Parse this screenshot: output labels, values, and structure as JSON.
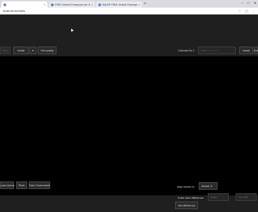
{
  "browser": {
    "tabs": [
      {
        "label": "",
        "active": true
      },
      {
        "label": "FIBS Global Champion for 3D",
        "active": false
      },
      {
        "label": "BAGR FIBS Global Champion",
        "active": false
      }
    ],
    "new_tab": "+",
    "window_controls": [
      "–",
      "□",
      "✕"
    ],
    "url": "localhost.domains"
  },
  "top_controls": {
    "left_btn_a": "Sex",
    "left_btn_b": "Install",
    "left_dropdown": "▾",
    "left_btn_quality": "Set quality",
    "channel_label": "Channel Nr 2",
    "channel_input_placeholder": "Set 2 / / / / / / / / ",
    "right_btn_install": "Install",
    "right_btn_edge": "Set"
  },
  "bottom_controls": {
    "btn_videos": "Load videos",
    "btn_pixel": "Pixel",
    "btn_screenshot": "Take Screenshot",
    "map_shown_label": "Map shown in",
    "map_select_value": "ahead",
    "time_diff_label": "Enter time difference",
    "time_diff_input": "Enter",
    "time_diff_extra": "Sec diff",
    "set_difference": "Set difference"
  }
}
